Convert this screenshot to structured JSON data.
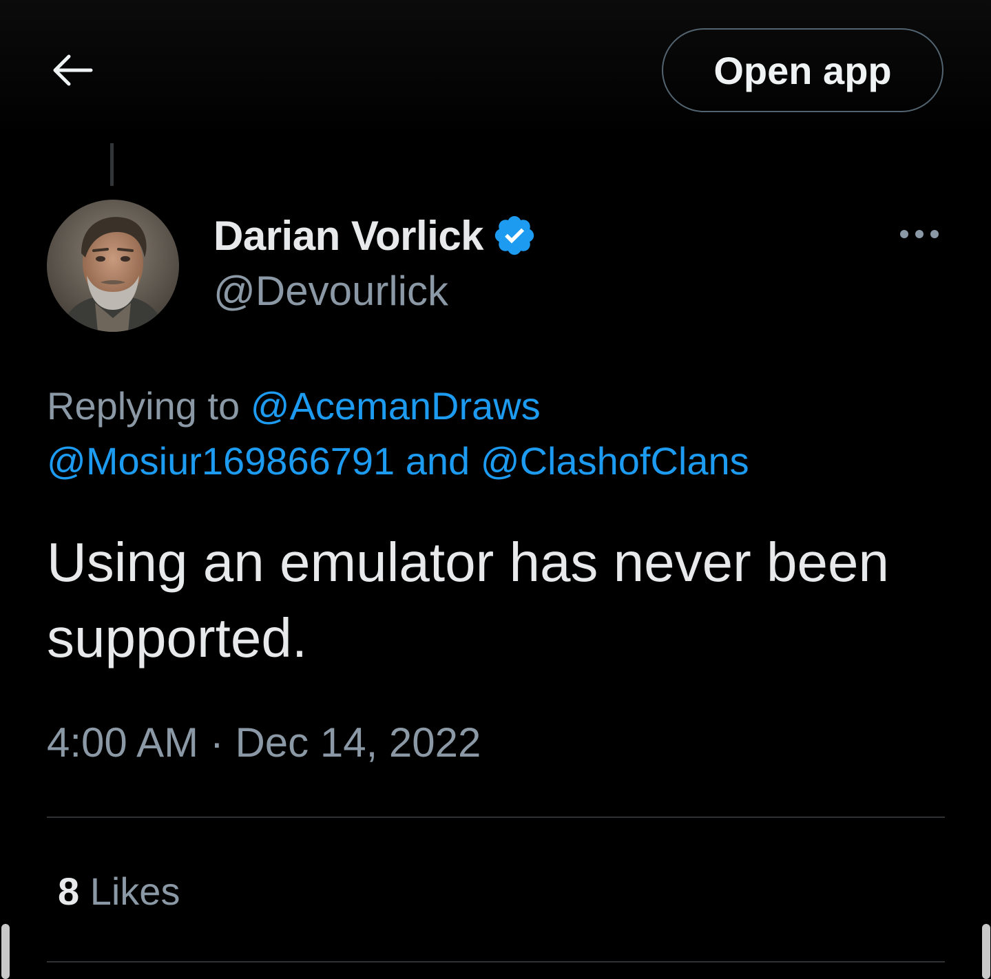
{
  "header": {
    "back_icon": "arrow-left-icon",
    "open_app_label": "Open app"
  },
  "tweet": {
    "author": {
      "display_name": "Darian Vorlick",
      "handle": "@Devourlick",
      "verified": true,
      "verified_icon": "verified-badge-icon",
      "verified_color": "#1d9bf0"
    },
    "more_icon": "more-horizontal-icon",
    "reply_context": {
      "prefix": "Replying to",
      "mention_1": "@AcemanDraws",
      "mention_2": "@Mosiur169866791",
      "joiner": "and",
      "mention_3": "@ClashofClans"
    },
    "text": "Using an emulator has never been supported.",
    "time": "4:00 AM",
    "separator": "·",
    "date": "Dec 14, 2022",
    "stats": {
      "likes_count": "8",
      "likes_label": "Likes"
    }
  },
  "colors": {
    "background": "#000000",
    "primary_text": "#e7e9ea",
    "secondary_text": "#8b98a5",
    "link": "#1d9bf0",
    "divider": "#2f3336"
  }
}
